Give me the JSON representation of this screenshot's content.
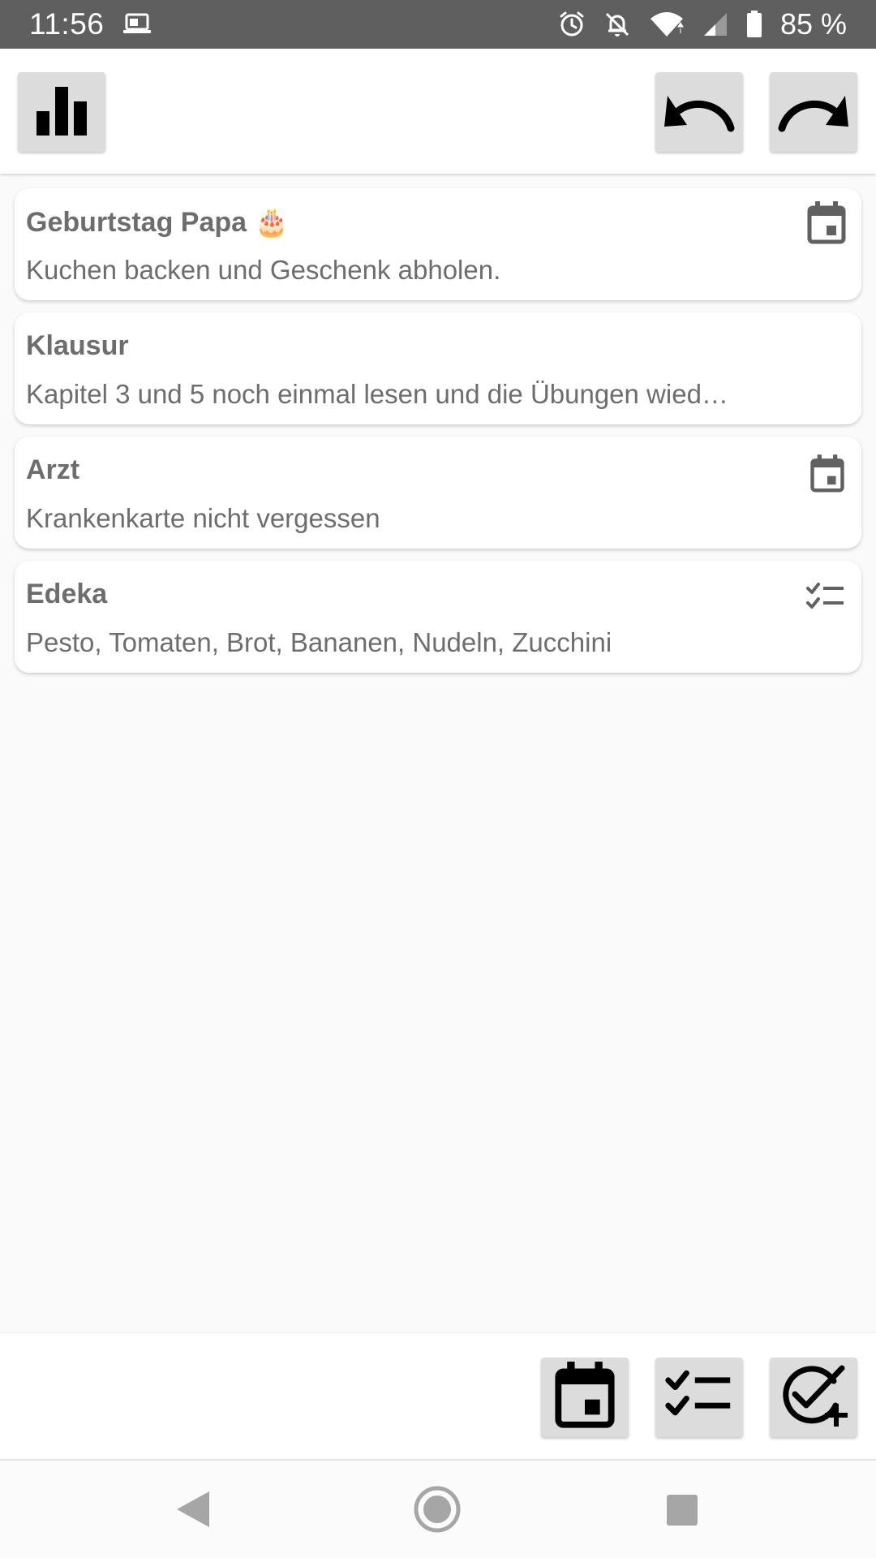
{
  "status_bar": {
    "time": "11:56",
    "battery": "85 %",
    "icons": [
      "cast-icon",
      "alarm-icon",
      "notifications-off-icon",
      "wifi-icon",
      "cell-signal-icon",
      "battery-icon"
    ]
  },
  "toolbar": {
    "stats_icon": "bar-chart-icon",
    "undo_icon": "undo-icon",
    "redo_icon": "redo-icon"
  },
  "notes": [
    {
      "title": "Geburtstag Papa 🎂",
      "text": "Kuchen backen und Geschenk abholen.",
      "icon": "calendar-icon"
    },
    {
      "title": "Klausur",
      "text": "Kapitel 3 und 5 noch einmal lesen und die Übungen wied…",
      "icon": ""
    },
    {
      "title": "Arzt",
      "text": "Krankenkarte nicht vergessen",
      "icon": "calendar-icon"
    },
    {
      "title": "Edeka",
      "text": "Pesto, Tomaten, Brot, Bananen, Nudeln, Zucchini",
      "icon": "checklist-icon"
    }
  ],
  "actions": {
    "new_event_icon": "calendar-icon",
    "new_checklist_icon": "checklist-icon",
    "new_task_icon": "add-task-icon"
  },
  "nav": {
    "back_icon": "back-triangle-icon",
    "home_icon": "home-circle-icon",
    "recents_icon": "recents-square-icon"
  },
  "colors": {
    "status_bar": "#5f5f5f",
    "card_text": "#6d6d6d",
    "button_bg": "#dcdcdc",
    "background": "#fafafa"
  }
}
